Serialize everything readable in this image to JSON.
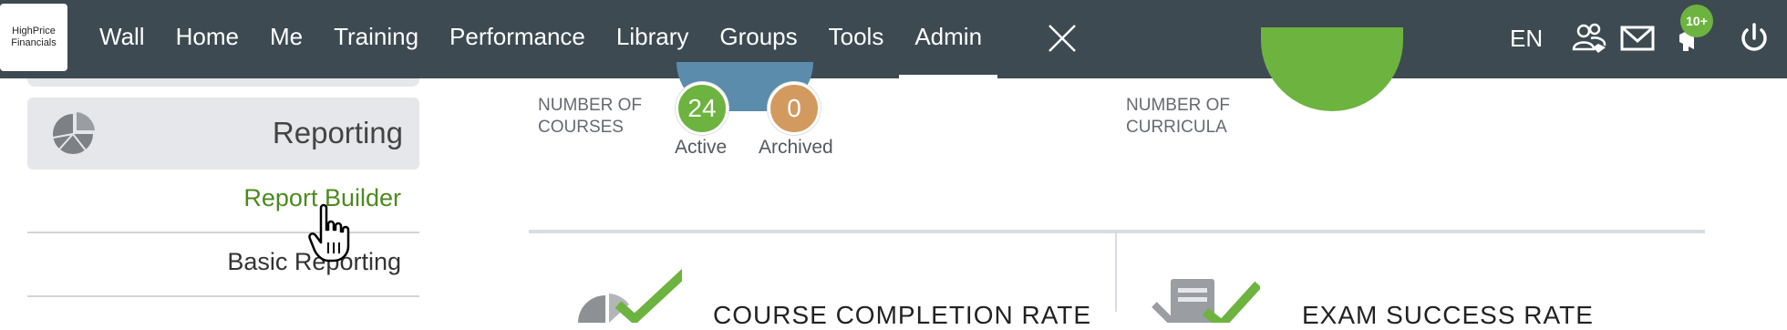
{
  "logo": {
    "text": "HighPrice\nFinancials"
  },
  "nav": {
    "items": [
      {
        "label": "Wall"
      },
      {
        "label": "Home"
      },
      {
        "label": "Me"
      },
      {
        "label": "Training"
      },
      {
        "label": "Performance"
      },
      {
        "label": "Library"
      },
      {
        "label": "Groups"
      },
      {
        "label": "Tools"
      },
      {
        "label": "Admin",
        "active": true
      }
    ],
    "close_icon": "close-icon"
  },
  "topbar_right": {
    "language": "EN",
    "notification_count": "10+",
    "icons": [
      "users-icon",
      "mail-icon",
      "megaphone-icon",
      "power-icon"
    ]
  },
  "sidebar": {
    "section_label": "Reporting",
    "section_icon": "pie-chart-icon",
    "items": [
      {
        "label": "Report Builder",
        "highlighted": true
      },
      {
        "label": "Basic Reporting"
      }
    ]
  },
  "courses": {
    "label_line1": "NUMBER OF",
    "label_line2": "COURSES",
    "active_count": "24",
    "active_label": "Active",
    "archived_count": "0",
    "archived_label": "Archived"
  },
  "curricula": {
    "label_line1": "NUMBER OF",
    "label_line2": "CURRICULA"
  },
  "stats": {
    "course_completion_title": "COURSE COMPLETION RATE",
    "exam_success_title": "EXAM SUCCESS RATE"
  },
  "colors": {
    "topbar": "#3d4a52",
    "accent_green": "#6db33f",
    "archived_orange": "#d39a60",
    "blue": "#5b8cab",
    "link_green": "#4c8a20"
  }
}
